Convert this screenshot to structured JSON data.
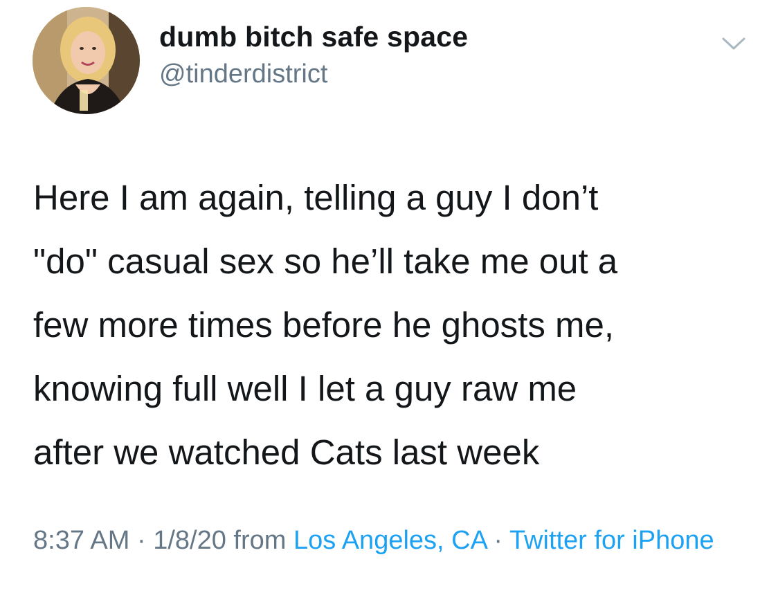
{
  "author": {
    "display_name": "dumb bitch safe space",
    "handle": "@tinderdistrict",
    "avatar_icon": "profile-photo"
  },
  "menu": {
    "icon": "chevron-down-icon"
  },
  "tweet": {
    "text_lines": [
      "Here I am again, telling a guy I don’t",
      "\"do\" casual sex so he’ll take me out a",
      "few more times before he ghosts me,",
      "knowing full well I let a guy raw me",
      "after we watched Cats last week"
    ]
  },
  "meta": {
    "time": "8:37 AM",
    "separator1": " · ",
    "date": "1/8/20",
    "from_label": " from ",
    "location": "Los Angeles, CA",
    "separator2": " · ",
    "source": "Twitter for iPhone"
  },
  "colors": {
    "text": "#14171a",
    "secondary": "#657786",
    "link": "#1da1f2",
    "chevron": "#aab8c2"
  }
}
